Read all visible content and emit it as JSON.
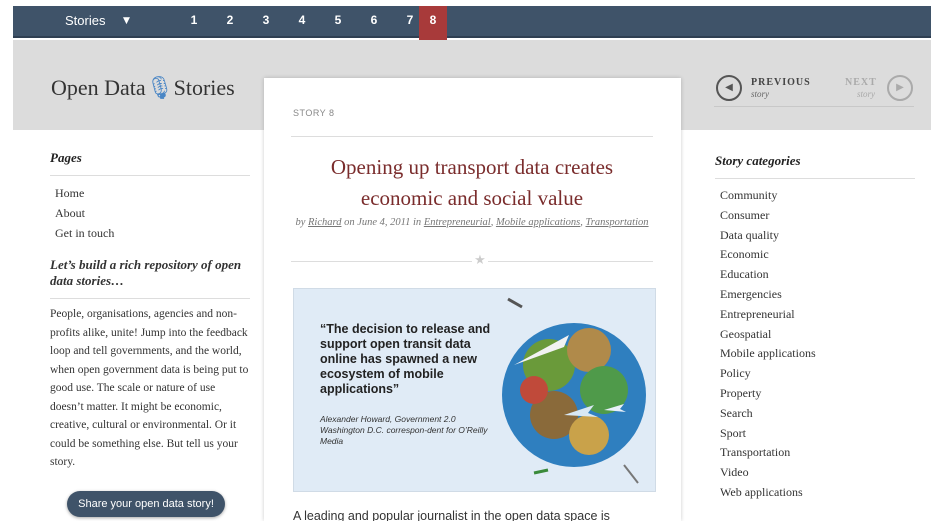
{
  "topbar": {
    "stories_label": "Stories",
    "pages": [
      "1",
      "2",
      "3",
      "4",
      "5",
      "6",
      "7",
      "8"
    ],
    "active_page": "8"
  },
  "logo": {
    "text_before": "Open Data",
    "text_after": "Stories"
  },
  "story_nav": {
    "previous_label": "PREVIOUS",
    "previous_sub": "story",
    "next_label": "NEXT",
    "next_sub": "story"
  },
  "left": {
    "pages_title": "Pages",
    "pages": [
      "Home",
      "About",
      "Get in touch"
    ],
    "build_title": "Let’s build a rich repository of open data stories…",
    "build_text": "People, organisations, agencies and non-profits alike, unite! Jump into the feedback loop and tell governments, and the world, when open government data is being put to good use. The scale or nature of use doesn’t matter. It might be economic, creative, cultural or environmental. Or it could be something else. But tell us your story.",
    "share_button": "Share your open data story!"
  },
  "story": {
    "number": "STORY 8",
    "title": "Opening up transport data creates economic and social value",
    "by": "by",
    "author": "Richard",
    "date_text": "on June 4, 2011 in",
    "categories": [
      "Entrepreneurial",
      "Mobile applications",
      "Transportation"
    ],
    "hero_quote": "“The decision to release and support open transit data online has spawned a new ecosystem of mobile applications”",
    "hero_attribution": "Alexander Howard, Government 2.0 Washington D.C. correspon-dent for O’Reilly Media",
    "body_start": "A leading and popular journalist in the open data space is"
  },
  "right": {
    "categories_title": "Story categories",
    "categories": [
      "Community",
      "Consumer",
      "Data quality",
      "Economic",
      "Education",
      "Emergencies",
      "Entrepreneurial",
      "Geospatial",
      "Mobile applications",
      "Policy",
      "Property",
      "Search",
      "Sport",
      "Transportation",
      "Video",
      "Web applications"
    ]
  },
  "colors": {
    "topbar": "#3f5369",
    "title_red": "#7a2c2c",
    "active_ribbon": "#a83a3a",
    "band": "#dcdcdc"
  }
}
